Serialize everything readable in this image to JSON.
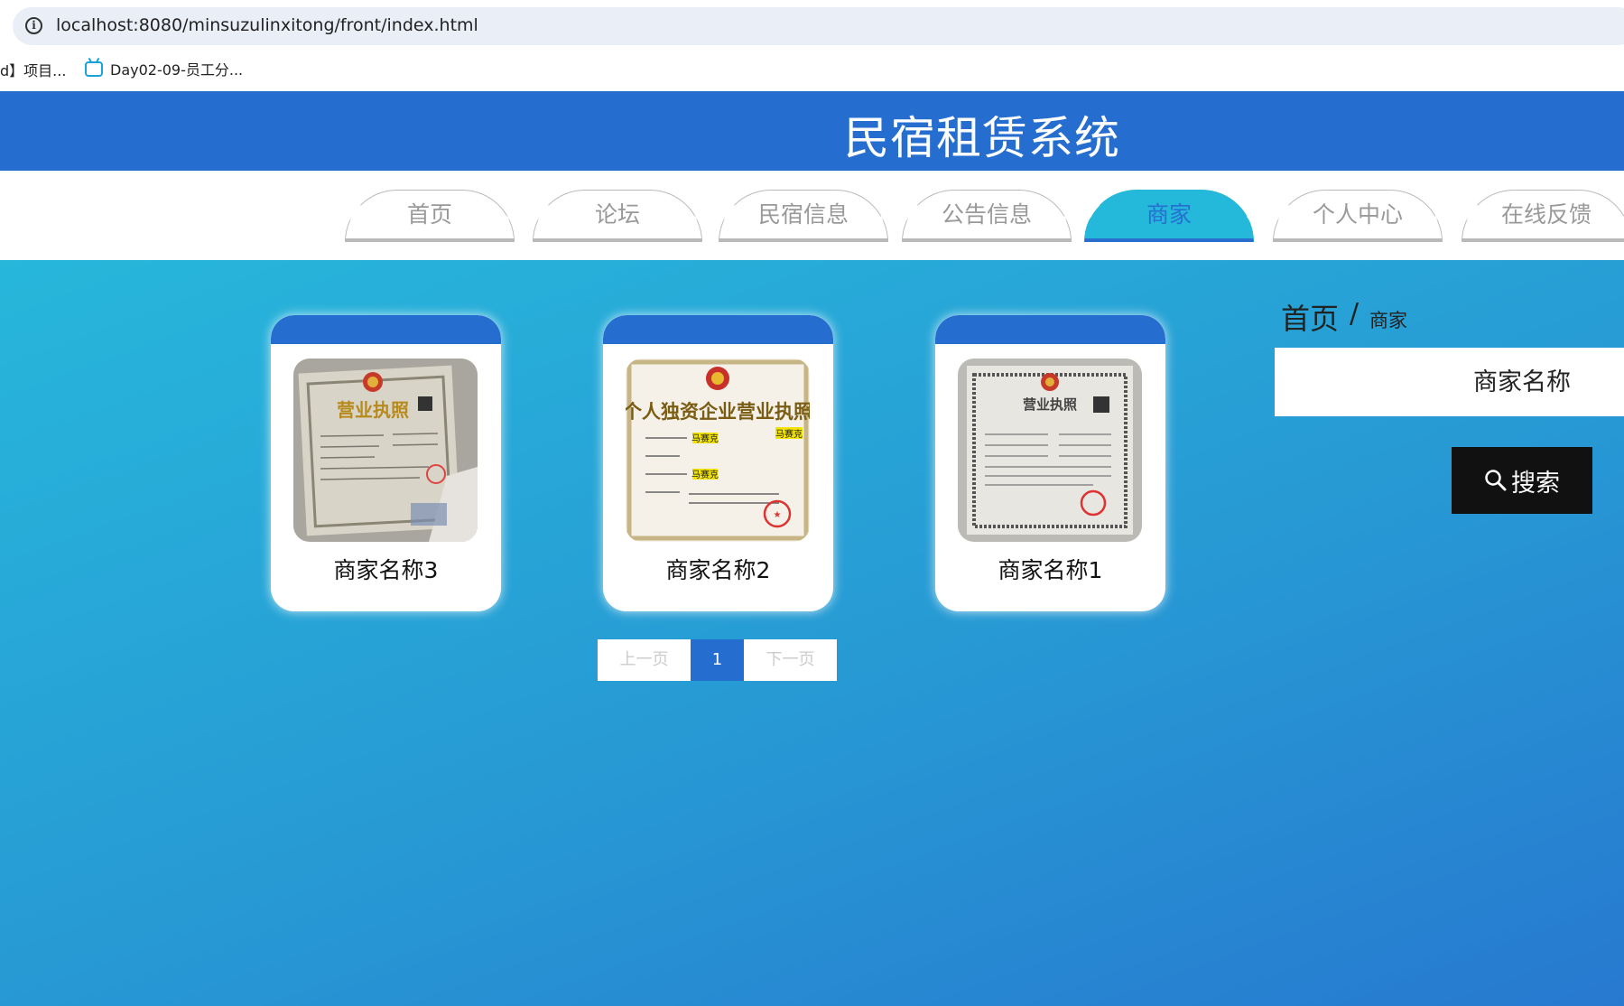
{
  "browser": {
    "url": "localhost:8080/minsuzulinxitong/front/index.html",
    "bookmark_left": "d】项目...",
    "bookmark_item": "Day02-09-员工分..."
  },
  "site": {
    "title": "民宿租赁系统"
  },
  "nav": {
    "tabs": [
      {
        "label": "首页",
        "active": false
      },
      {
        "label": "论坛",
        "active": false
      },
      {
        "label": "民宿信息",
        "active": false
      },
      {
        "label": "公告信息",
        "active": false
      },
      {
        "label": "商家",
        "active": true
      },
      {
        "label": "个人中心",
        "active": false
      },
      {
        "label": "在线反馈",
        "active": false
      }
    ]
  },
  "cards": [
    {
      "name": "商家名称3"
    },
    {
      "name": "商家名称2"
    },
    {
      "name": "商家名称1"
    }
  ],
  "cert_text": {
    "c1_title": "营业执照",
    "c2_title": "个人独资企业营业执照",
    "c2_stamp": "马赛克",
    "c3_title": "营业执照"
  },
  "pagination": {
    "prev": "上一页",
    "current": "1",
    "next": "下一页"
  },
  "breadcrumb": {
    "home": "首页",
    "separator": "/",
    "current": "商家"
  },
  "search": {
    "placeholder": "商家名称",
    "button": "搜索"
  },
  "colors": {
    "header": "#266dd0",
    "active_tab": "#24b8da",
    "button": "#111111"
  }
}
